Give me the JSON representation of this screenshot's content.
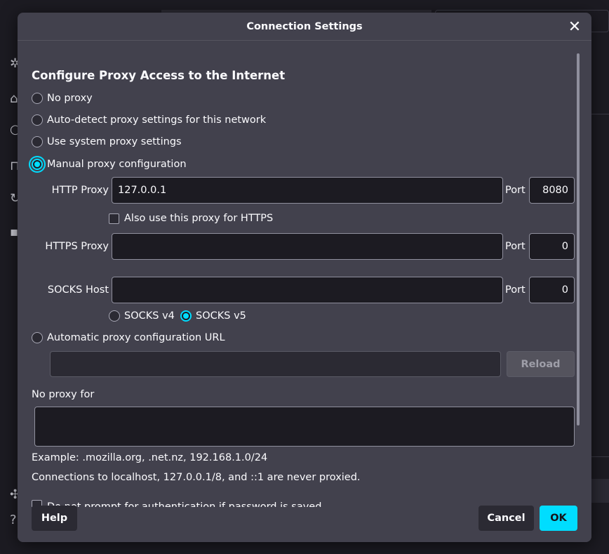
{
  "dialog": {
    "title": "Connection Settings",
    "section_title": "Configure Proxy Access to the Internet"
  },
  "proxy_options": {
    "no_proxy": "No proxy",
    "auto_detect": "Auto-detect proxy settings for this network",
    "system": "Use system proxy settings",
    "manual": "Manual proxy configuration",
    "auto_url": "Automatic proxy configuration URL",
    "selected": "manual"
  },
  "http": {
    "label": "HTTP Proxy",
    "value": "127.0.0.1",
    "port_label": "Port",
    "port": "8080",
    "also_https": "Also use this proxy for HTTPS",
    "also_https_checked": false
  },
  "https": {
    "label": "HTTPS Proxy",
    "value": "",
    "port_label": "Port",
    "port": "0"
  },
  "socks": {
    "label": "SOCKS Host",
    "value": "",
    "port_label": "Port",
    "port": "0",
    "v4": "SOCKS v4",
    "v5": "SOCKS v5",
    "selected": "v5"
  },
  "auto_url": {
    "value": "",
    "reload": "Reload"
  },
  "no_proxy_for": {
    "label": "No proxy for",
    "value": "",
    "example": "Example: .mozilla.org, .net.nz, 192.168.1.0/24",
    "note": "Connections to localhost, 127.0.0.1/8, and ::1 are never proxied."
  },
  "auth_prompt": {
    "label": "Do not prompt for authentication if password is saved"
  },
  "buttons": {
    "help": "Help",
    "cancel": "Cancel",
    "ok": "OK"
  },
  "colors": {
    "accent": "#00ddff",
    "dialog_bg": "#42414d",
    "input_bg": "#1c1b22"
  }
}
